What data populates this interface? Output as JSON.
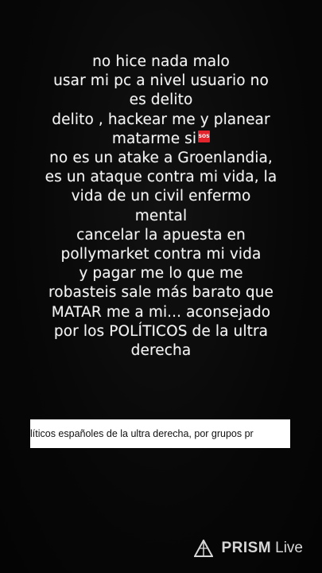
{
  "message": {
    "lines": [
      "no hice nada malo",
      "usar mi pc a nivel usuario no",
      "es delito",
      "delito , hackear me y planear",
      "matarme si",
      "no es un atake a Groenlandia,",
      "es un ataque contra mi vida, la",
      "vida de un civil enfermo",
      "mental",
      "cancelar la apuesta en",
      "pollymarket contra mi vida",
      "y pagar me lo que me",
      "robasteis sale más barato que",
      "MATAR me a mi... aconsejado",
      "por los POLÍTICOS de la ultra",
      "derecha"
    ],
    "sos_label": "SOS"
  },
  "ticker": {
    "text": "líticos españoles de la ultra derecha, por grupos pr"
  },
  "watermark": {
    "brand": "PRISM",
    "suffix": "Live",
    "icon": "prism-logo-icon"
  },
  "colors": {
    "background": "#050505",
    "text": "#f4f4f4",
    "sos_red": "#e3262d",
    "ticker_bg": "#ffffff"
  }
}
